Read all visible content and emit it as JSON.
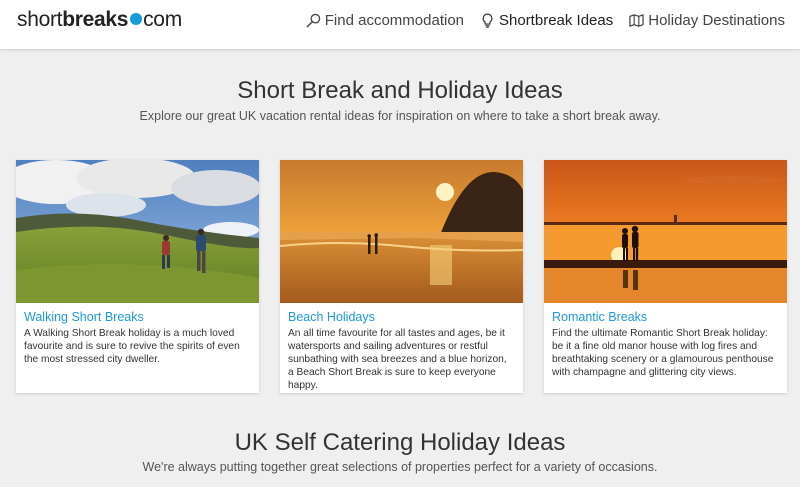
{
  "header": {
    "logo": {
      "part1": "short",
      "part2": "breaks",
      "part3": "com"
    },
    "nav": [
      {
        "label": "Find accommodation",
        "icon": "search-icon"
      },
      {
        "label": "Shortbreak Ideas",
        "icon": "lightbulb-icon"
      },
      {
        "label": "Holiday Destinations",
        "icon": "map-icon"
      }
    ]
  },
  "section1": {
    "title": "Short Break and Holiday Ideas",
    "subtitle": "Explore our great UK vacation rental ideas for inspiration on where to take a short break away."
  },
  "cards": [
    {
      "title": "Walking Short Breaks",
      "text": "A Walking Short Break holiday is a much loved favourite and is sure to revive the spirits of even the most stressed city dweller.",
      "image": "walking-photo"
    },
    {
      "title": "Beach Holidays",
      "text": "An all time favourite for all tastes and ages, be it watersports and sailing adventures or restful sunbathing with sea breezes and a blue horizon, a Beach Short Break is sure to keep everyone happy.",
      "image": "beach-sunset-photo"
    },
    {
      "title": "Romantic Breaks",
      "text": "Find the ultimate Romantic Short Break holiday: be it a fine old manor house with log fires and breathtaking scenery or a glamourous penthouse with champagne and glittering city views.",
      "image": "couple-sunset-photo"
    }
  ],
  "section2": {
    "title": "UK Self Catering Holiday Ideas",
    "subtitle": "We're always putting together great selections of properties perfect for a variety of occasions."
  },
  "colors": {
    "accent": "#1a9bd7",
    "background": "#efefef"
  }
}
